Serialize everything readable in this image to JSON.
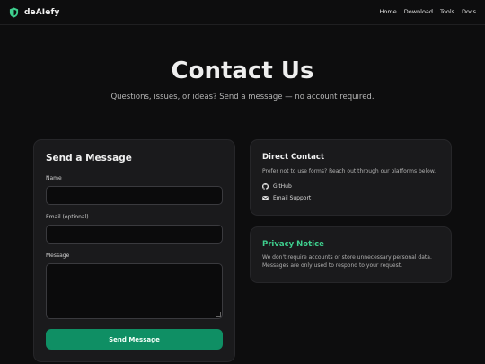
{
  "brand": {
    "name": "deAIefy",
    "accent": "#3ecf8e"
  },
  "nav": {
    "links": [
      "Home",
      "Download",
      "Tools",
      "Docs"
    ]
  },
  "hero": {
    "title": "Contact Us",
    "subtitle": "Questions, issues, or ideas? Send a message — no account required."
  },
  "form": {
    "title": "Send a Message",
    "name_label": "Name",
    "name_value": "",
    "email_label": "Email (optional)",
    "email_value": "",
    "message_label": "Message",
    "message_value": "",
    "submit_label": "Send Message"
  },
  "direct_contact": {
    "title": "Direct Contact",
    "text": "Prefer not to use forms? Reach out through our platforms below.",
    "links": [
      {
        "label": "GitHub",
        "icon": "github-icon"
      },
      {
        "label": "Email Support",
        "icon": "mail-icon"
      }
    ]
  },
  "privacy": {
    "title": "Privacy Notice",
    "text": "We don't require accounts or store unnecessary personal data. Messages are only used to respond to your request."
  },
  "colors": {
    "background": "#0d0d0e",
    "card": "#1a1a1c",
    "button": "#0f8f64",
    "privacy_title": "#3ecf8e"
  }
}
